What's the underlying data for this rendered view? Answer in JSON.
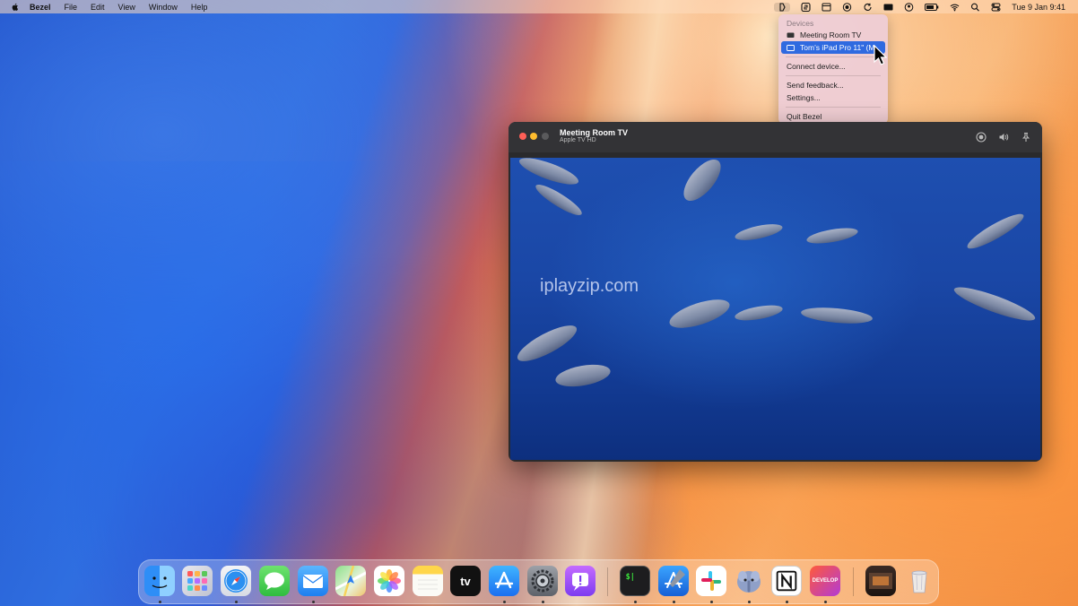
{
  "menubar": {
    "app_name": "Bezel",
    "menus": [
      "File",
      "Edit",
      "View",
      "Window",
      "Help"
    ],
    "clock": "Tue 9 Jan  9:41",
    "tray_icons": [
      "bezel-icon",
      "shazam-icon",
      "calendar-icon",
      "record-icon",
      "refresh-icon",
      "card-icon",
      "account-icon",
      "battery-icon",
      "wifi-icon",
      "search-icon",
      "control-center-icon"
    ]
  },
  "dropdown": {
    "header": "Devices",
    "devices": [
      {
        "label": "Meeting Room TV",
        "icon": "tv-icon"
      },
      {
        "label": "Tom’s iPad Pro 11\" (M",
        "icon": "ipad-icon",
        "selected": true
      }
    ],
    "connect": "Connect device...",
    "feedback": "Send feedback...",
    "settings": "Settings...",
    "quit": "Quit Bezel"
  },
  "window": {
    "title": "Meeting Room TV",
    "subtitle": "Apple TV HD",
    "watermark": "iplayzip.com"
  },
  "dock": {
    "apps": [
      "Finder",
      "Launchpad",
      "Safari",
      "Messages",
      "Mail",
      "Maps",
      "Photos",
      "Notes",
      "TV",
      "App Store",
      "System Settings",
      "Feedback Assistant",
      "Terminal",
      "Xcode",
      "Slack",
      "TablePlus",
      "Notion",
      "Develop",
      "Screenshot",
      "Trash"
    ],
    "tv_label": "tv",
    "develop_label": "DEVELOP"
  },
  "colors": {
    "accent": "#2f6ae0",
    "close": "#ff5f57",
    "minimize": "#febc2e"
  }
}
